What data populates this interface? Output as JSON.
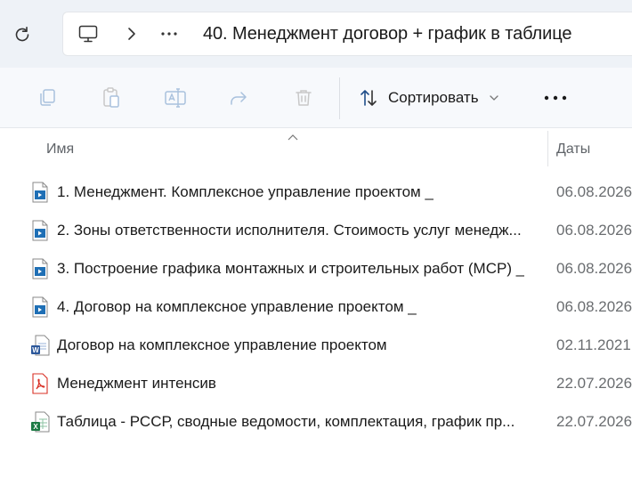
{
  "address": {
    "path": "40. Менеджмент договор + график в таблице",
    "overflow_label": "···"
  },
  "toolbar": {
    "sort_label": "Сортировать",
    "more_label": "•••"
  },
  "columns": {
    "name": "Имя",
    "date": "Даты"
  },
  "files": [
    {
      "name": "1. Менеджмент. Комплексное управление проектом _",
      "date": "06.08.2026",
      "type": "video"
    },
    {
      "name": "2. Зоны ответственности исполнителя. Стоимость услуг менедж...",
      "date": "06.08.2026",
      "type": "video"
    },
    {
      "name": "3. Построение графика монтажных и строительных работ (МСР) _",
      "date": "06.08.2026",
      "type": "video"
    },
    {
      "name": "4. Договор на комплексное управление проектом _",
      "date": "06.08.2026",
      "type": "video"
    },
    {
      "name": "Договор на комплексное управление проектом",
      "date": "02.11.2021",
      "type": "word"
    },
    {
      "name": "Менеджмент  интенсив",
      "date": "22.07.2026",
      "type": "pdf"
    },
    {
      "name": "Таблица - РССР, сводные ведомости, комплектация, график пр...",
      "date": "22.07.2026",
      "type": "excel"
    }
  ],
  "colors": {
    "address_bar_bg": "#eef2f7",
    "toolbar_bg": "#f7f9fc",
    "video_icon": "#1f6fb5",
    "word_icon": "#2b579a",
    "pdf_icon": "#d93025",
    "excel_icon": "#1d7a44"
  }
}
